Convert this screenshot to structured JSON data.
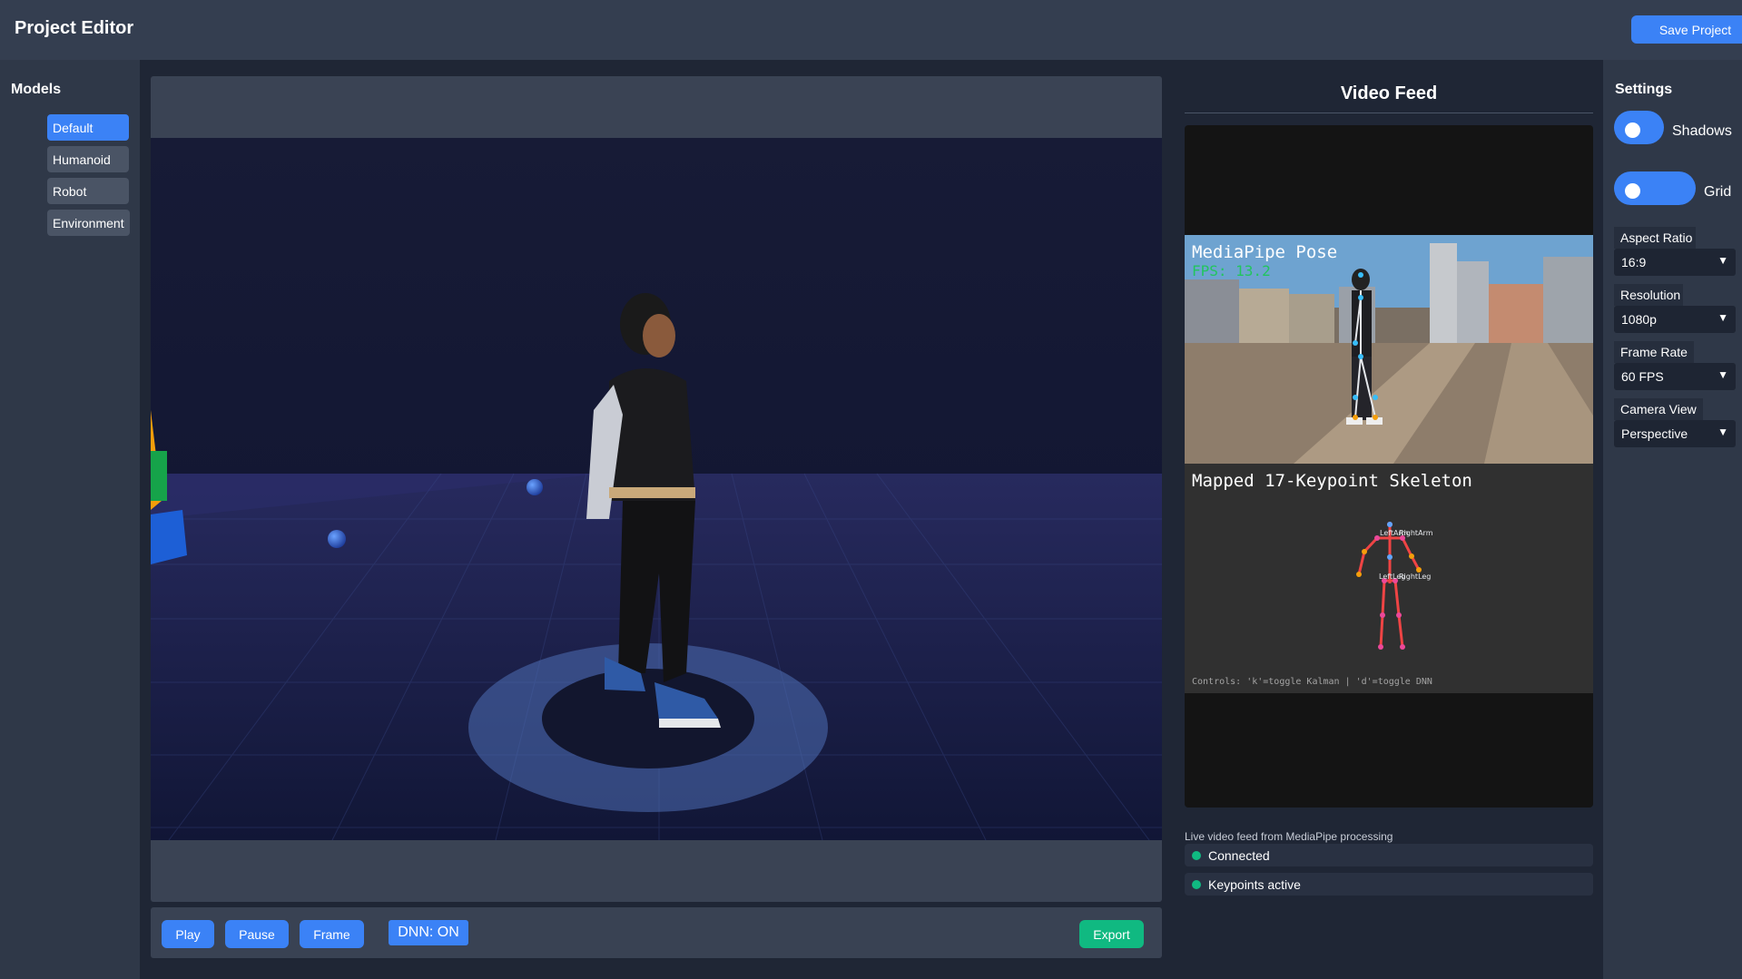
{
  "header": {
    "title": "Project Editor",
    "save_label": "Save Project"
  },
  "models": {
    "title": "Models",
    "items": [
      {
        "label": "Default",
        "active": true
      },
      {
        "label": "Humanoid",
        "active": false
      },
      {
        "label": "Robot",
        "active": false
      },
      {
        "label": "Environment",
        "active": false
      }
    ]
  },
  "controls": {
    "play_label": "Play",
    "pause_label": "Pause",
    "frame_label": "Frame",
    "dnn_label": "DNN: ON",
    "export_label": "Export"
  },
  "video": {
    "title": "Video Feed",
    "pose_title": "MediaPipe Pose",
    "fps": "FPS: 13.2",
    "skeleton_title": "Mapped 17-Keypoint Skeleton",
    "joint_labels": [
      "LeftArm",
      "RightArm",
      "LeftLeg",
      "RightLeg"
    ],
    "controls_hint": "Controls: 'k'=toggle Kalman | 'd'=toggle DNN",
    "caption": "Live video feed from MediaPipe processing",
    "status": [
      "Connected",
      "Keypoints active"
    ]
  },
  "settings": {
    "title": "Settings",
    "shadows_label": "Shadows",
    "grid_label": "Grid",
    "aspect_ratio": {
      "label": "Aspect Ratio",
      "value": "16:9"
    },
    "resolution": {
      "label": "Resolution",
      "value": "1080p"
    },
    "frame_rate": {
      "label": "Frame Rate",
      "value": "60 FPS"
    },
    "camera_view": {
      "label": "Camera View",
      "value": "Perspective"
    }
  },
  "colors": {
    "accent": "#3b82f6",
    "export": "#10b981",
    "status": "#10b981"
  },
  "icons": {
    "dropdown": "chevron-down-icon",
    "status": "status-dot-icon"
  }
}
